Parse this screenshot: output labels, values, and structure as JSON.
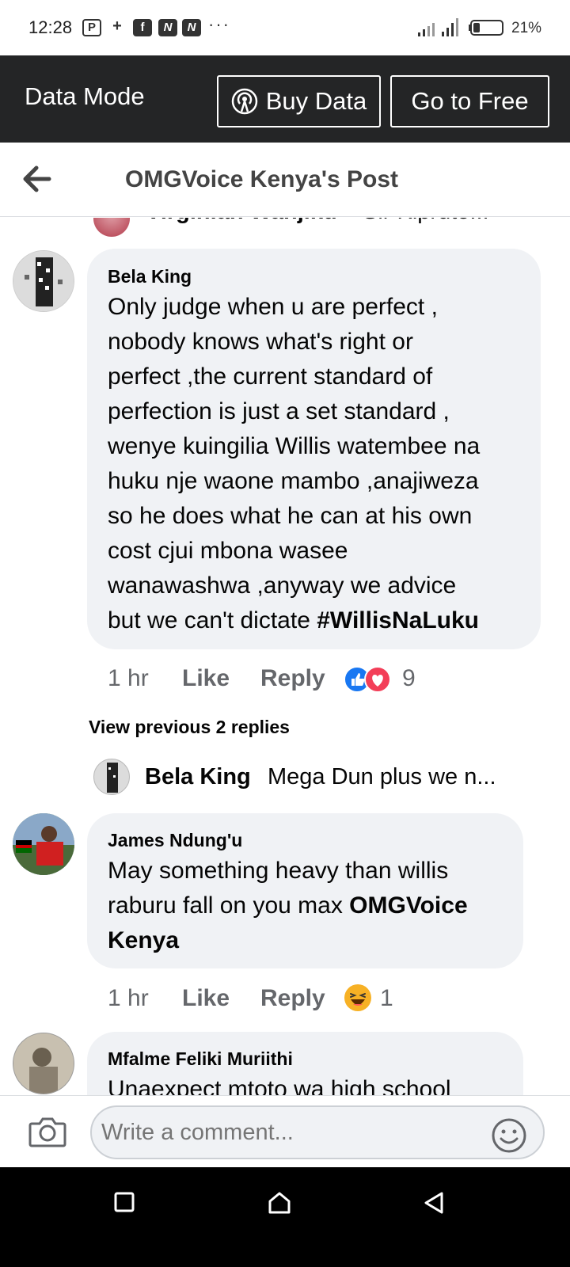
{
  "status_bar": {
    "time": "12:28",
    "notification_icons": [
      "P",
      "+",
      "f",
      "N",
      "N"
    ],
    "more": "···",
    "battery_percent": "21%",
    "battery_level": 0.21
  },
  "data_mode": {
    "label": "Data Mode",
    "buy_data": "Buy Data",
    "go_free": "Go to Free"
  },
  "header": {
    "title": "OMGVoice Kenya's Post"
  },
  "top_reply": {
    "author": "Virginiah Wanjiku",
    "preview": "Sir Kipruto..."
  },
  "comments": [
    {
      "author": "Bela King",
      "text": "Only judge when u are perfect ,\nnobody knows what's right or\nperfect ,the current standard of\nperfection is just a set standard ,\nwenye kuingilia Willis watembee na\nhuku nje waone mambo ,anajiweza\nso he does what he can at his own\ncost cjui mbona wasee\nwanawashwa ,anyway we advice\nbut we can't dictate ",
      "hashtag": "#WillisNaLuku",
      "time": "1 hr",
      "like": "Like",
      "reply": "Reply",
      "reaction_count": "9"
    },
    {
      "author": "James Ndung'u",
      "text": "May something heavy than willis\nraburu fall on you max ",
      "mention_line1": "OMGVoice",
      "mention_line2": "Kenya",
      "time": "1 hr",
      "like": "Like",
      "reply": "Reply",
      "reaction_count": "1"
    },
    {
      "author": "Mfalme Feliki Muriithi",
      "text": "Unaexpect mtoto wa high school"
    }
  ],
  "view_previous": "View previous 2 replies",
  "nested_reply": {
    "author": "Bela King",
    "preview": "Mega Dun plus we n..."
  },
  "composer": {
    "placeholder": "Write a comment..."
  },
  "colors": {
    "data_bar": "#242526",
    "bubble": "#f0f2f5",
    "like_blue": "#1877f2",
    "love_red": "#f33e58",
    "haha_yellow": "#f7b125",
    "meta_gray": "#65676b"
  }
}
